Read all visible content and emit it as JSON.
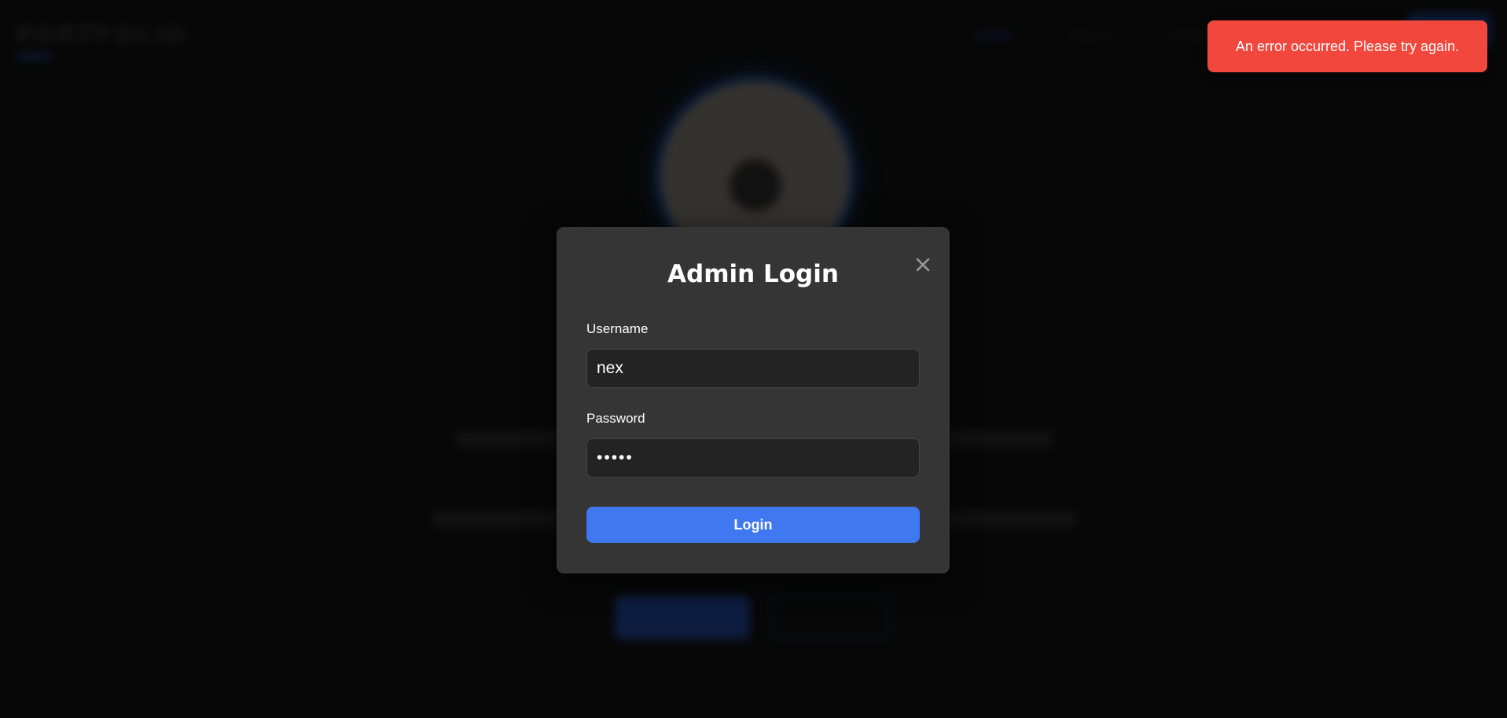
{
  "background": {
    "logo_text": "PORTFOLIO",
    "nav_items": [
      "HOME",
      "SKILLS",
      "PROJECTS"
    ]
  },
  "modal": {
    "title": "Admin Login",
    "username_label": "Username",
    "username_value": "nex",
    "password_label": "Password",
    "password_value": "•••••",
    "login_label": "Login"
  },
  "toast": {
    "message": "An error occurred. Please try again."
  },
  "colors": {
    "toast_bg": "#f2473d",
    "login_button": "#3f78f0",
    "modal_bg": "#353535"
  },
  "icons": {
    "close": "close-icon"
  }
}
